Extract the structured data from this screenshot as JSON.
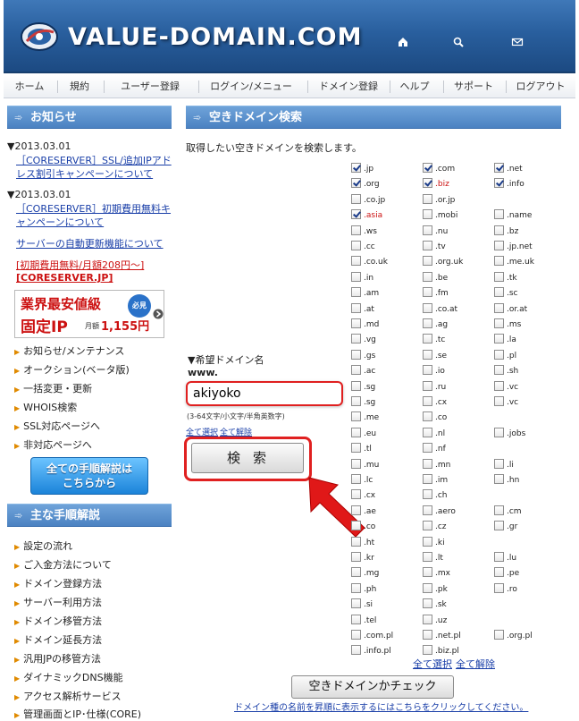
{
  "header": {
    "logo_text": "VALUE-DOMAIN.COM",
    "icons": [
      "home-icon",
      "search-icon",
      "mail-icon"
    ]
  },
  "nav": {
    "items": [
      "ホーム",
      "規約",
      "ユーザー登録",
      "ログイン/メニュー",
      "ドメイン登録",
      "ヘルプ",
      "サポート",
      "ログアウト"
    ]
  },
  "sidebar": {
    "news_title": "お知らせ",
    "news": [
      {
        "date": "▼2013.03.01",
        "link": "［CORESERVER］SSL/追加IPアドレス割引キャンペーンについて"
      },
      {
        "date": "▼2013.03.01",
        "link": "［CORESERVER］初期費用無料キャンペーンについて"
      }
    ],
    "auto_renew_link": "サーバーの自動更新機能について",
    "promo_text": "[初期費用無料/月額208円～]",
    "promo_site": "[CORESERVER.JP]",
    "banner": {
      "line1": "業界最安値級",
      "line2": "固定IP",
      "price_label": "月額",
      "price": "1,155円",
      "badge": "必見"
    },
    "menu_items": [
      "お知らせ/メンテナンス",
      "オークション(ベータ版)",
      "一括変更・更新",
      "WHOIS検索",
      "SSL対応ページへ",
      "非対応ページへ"
    ],
    "guide_button": {
      "line1": "全ての手順解説は",
      "line2": "こちらから"
    },
    "procedures_title": "主な手順解説",
    "procedures": [
      "設定の流れ",
      "ご入金方法について",
      "ドメイン登録方法",
      "サーバー利用方法",
      "ドメイン移管方法",
      "ドメイン延長方法",
      "汎用JPの移管方法",
      "ダイナミックDNS機能",
      "アクセス解析サービス",
      "管理画面とIP･仕様(CORE)"
    ]
  },
  "main": {
    "title": "空きドメイン検索",
    "intro": "取得したい空きドメインを検索します。",
    "domain_label": "▼希望ドメイン名",
    "www_label": "www.",
    "input_value": "akiyoko",
    "input_hint": "(3-64文字/小文字/半角英数字)",
    "select_all": "全て選択",
    "deselect_all": "全て解除",
    "search_button": "検索",
    "check_button": "空きドメインかチェック",
    "sort_link": "ドメイン種の名前を昇順に表示するにはこちらをクリックしてください。",
    "tlds": [
      [
        {
          "name": ".jp",
          "checked": true
        },
        {
          "name": ".com",
          "checked": true
        },
        {
          "name": ".net",
          "checked": true
        }
      ],
      [
        {
          "name": ".org",
          "checked": true
        },
        {
          "name": ".biz",
          "checked": true,
          "red": true
        },
        {
          "name": ".info",
          "checked": true
        }
      ],
      [
        {
          "name": ".co.jp",
          "checked": false
        },
        {
          "name": ".or.jp",
          "checked": false
        },
        null
      ],
      [
        {
          "name": ".asia",
          "checked": true,
          "red": true
        },
        {
          "name": ".mobi",
          "checked": false
        },
        {
          "name": ".name",
          "checked": false
        }
      ],
      [
        {
          "name": ".ws",
          "checked": false
        },
        {
          "name": ".nu",
          "checked": false
        },
        {
          "name": ".bz",
          "checked": false
        }
      ],
      [
        {
          "name": ".cc",
          "checked": false
        },
        {
          "name": ".tv",
          "checked": false
        },
        {
          "name": ".jp.net",
          "checked": false
        }
      ],
      [
        {
          "name": ".co.uk",
          "checked": false
        },
        {
          "name": ".org.uk",
          "checked": false
        },
        {
          "name": ".me.uk",
          "checked": false
        }
      ],
      [
        {
          "name": ".in",
          "checked": false
        },
        {
          "name": ".be",
          "checked": false
        },
        {
          "name": ".tk",
          "checked": false
        }
      ],
      [
        {
          "name": ".am",
          "checked": false
        },
        {
          "name": ".fm",
          "checked": false
        },
        {
          "name": ".sc",
          "checked": false
        }
      ],
      [
        {
          "name": ".at",
          "checked": false
        },
        {
          "name": ".co.at",
          "checked": false
        },
        {
          "name": ".or.at",
          "checked": false
        }
      ],
      [
        {
          "name": ".md",
          "checked": false
        },
        {
          "name": ".ag",
          "checked": false
        },
        {
          "name": ".ms",
          "checked": false
        }
      ],
      [
        {
          "name": ".vg",
          "checked": false
        },
        {
          "name": ".tc",
          "checked": false
        },
        {
          "name": ".la",
          "checked": false
        }
      ],
      [
        {
          "name": ".gs",
          "checked": false
        },
        {
          "name": ".se",
          "checked": false
        },
        {
          "name": ".pl",
          "checked": false
        }
      ],
      [
        {
          "name": ".ac",
          "checked": false
        },
        {
          "name": ".io",
          "checked": false
        },
        {
          "name": ".sh",
          "checked": false
        }
      ],
      [
        {
          "name": ".sg",
          "checked": false
        },
        {
          "name": ".ru",
          "checked": false
        },
        {
          "name": ".vc",
          "checked": false
        }
      ],
      [
        {
          "name": ".sg",
          "checked": false
        },
        {
          "name": ".cx",
          "checked": false
        },
        {
          "name": ".vc",
          "checked": false
        }
      ],
      [
        {
          "name": ".me",
          "checked": false
        },
        {
          "name": ".co",
          "checked": false
        },
        null
      ],
      [
        {
          "name": ".eu",
          "checked": false
        },
        {
          "name": ".nl",
          "checked": false
        },
        {
          "name": ".jobs",
          "checked": false
        }
      ],
      [
        {
          "name": ".tl",
          "checked": false
        },
        {
          "name": ".nf",
          "checked": false
        },
        null
      ],
      [
        {
          "name": ".mu",
          "checked": false
        },
        {
          "name": ".mn",
          "checked": false
        },
        {
          "name": ".li",
          "checked": false
        }
      ],
      [
        {
          "name": ".lc",
          "checked": false
        },
        {
          "name": ".im",
          "checked": false
        },
        {
          "name": ".hn",
          "checked": false
        }
      ],
      [
        {
          "name": ".cx",
          "checked": false
        },
        {
          "name": ".ch",
          "checked": false
        },
        null
      ],
      [
        {
          "name": ".ae",
          "checked": false
        },
        {
          "name": ".aero",
          "checked": false
        },
        {
          "name": ".cm",
          "checked": false
        }
      ],
      [
        {
          "name": ".co",
          "checked": false
        },
        {
          "name": ".cz",
          "checked": false
        },
        {
          "name": ".gr",
          "checked": false
        }
      ],
      [
        {
          "name": ".ht",
          "checked": false
        },
        {
          "name": ".ki",
          "checked": false
        },
        null
      ],
      [
        {
          "name": ".kr",
          "checked": false
        },
        {
          "name": ".lt",
          "checked": false
        },
        {
          "name": ".lu",
          "checked": false
        }
      ],
      [
        {
          "name": ".mg",
          "checked": false
        },
        {
          "name": ".mx",
          "checked": false
        },
        {
          "name": ".pe",
          "checked": false
        }
      ],
      [
        {
          "name": ".ph",
          "checked": false
        },
        {
          "name": ".pk",
          "checked": false
        },
        {
          "name": ".ro",
          "checked": false
        }
      ],
      [
        {
          "name": ".si",
          "checked": false
        },
        {
          "name": ".sk",
          "checked": false
        },
        null
      ],
      [
        {
          "name": ".tel",
          "checked": false
        },
        {
          "name": ".uz",
          "checked": false
        },
        null
      ],
      [
        {
          "name": ".com.pl",
          "checked": false
        },
        {
          "name": ".net.pl",
          "checked": false
        },
        {
          "name": ".org.pl",
          "checked": false
        }
      ],
      [
        {
          "name": ".info.pl",
          "checked": false
        },
        {
          "name": ".biz.pl",
          "checked": false
        },
        null
      ]
    ]
  }
}
